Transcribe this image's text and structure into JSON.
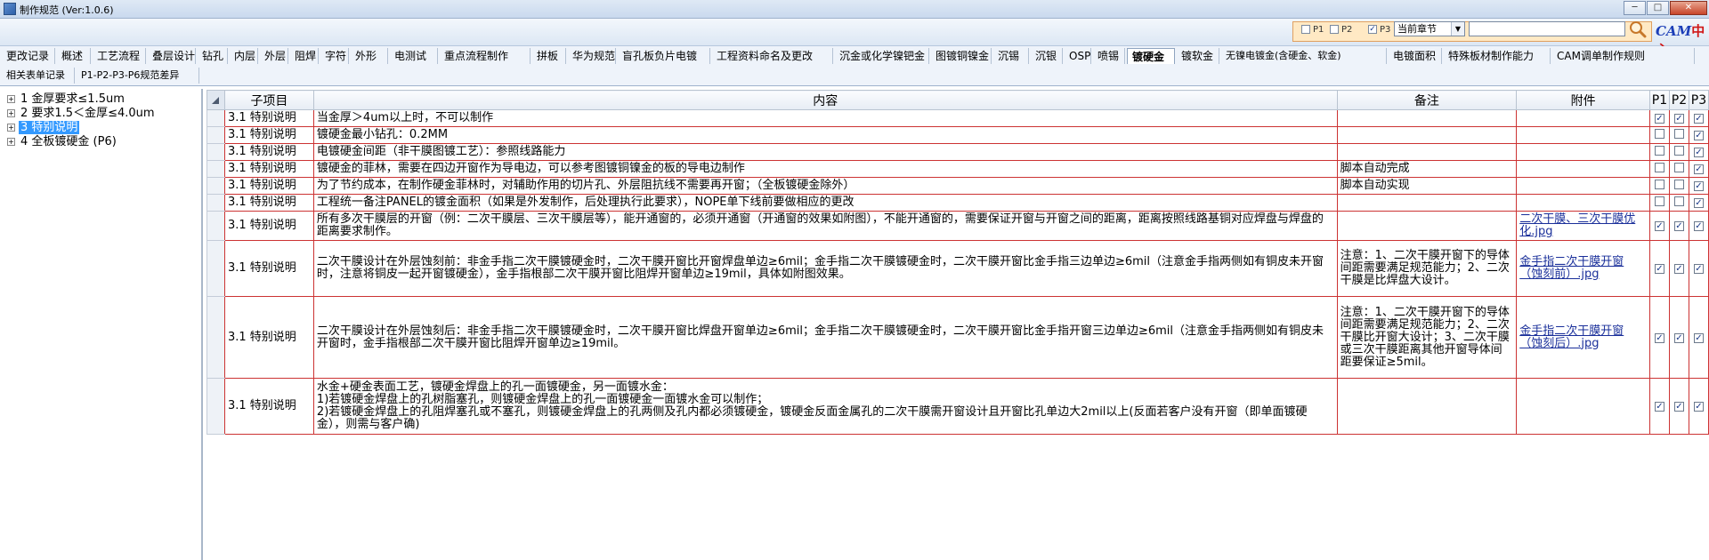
{
  "window": {
    "title": "制作规范 (Ver:1.0.6)",
    "controls": [
      "─",
      "□",
      "✕"
    ]
  },
  "toolbar": {
    "p1": {
      "label": "P1",
      "checked": false
    },
    "p2": {
      "label": "P2",
      "checked": false
    },
    "p3": {
      "label": "P3",
      "checked": true
    },
    "scope_select": "当前章节",
    "search_value": "",
    "brand_prefix": "CAM",
    "brand_suffix": "中心"
  },
  "tabs_row1": [
    "更改记录",
    "概述",
    "工艺流程",
    "叠层设计",
    "钻孔",
    "内层",
    "外层",
    "阻焊",
    "字符",
    "外形",
    "电测试",
    "重点流程制作",
    "拼板",
    "华为规范",
    "盲孔板负片电镀",
    "工程资料命名及更改",
    "沉金或化学镍钯金",
    "图镀铜镍金",
    "沉锡",
    "沉银",
    "OSP",
    "喷锡",
    "镀硬金",
    "镀软金",
    "无镍电镀金(含硬金、软金)",
    "电镀面积",
    "特殊板材制作能力",
    "CAM调单制作规则"
  ],
  "tabs_row2": [
    "相关表单记录",
    "P1-P2-P3-P6规范差异"
  ],
  "active_tab": "镀硬金",
  "tree": [
    {
      "label": "1 金厚要求≤1.5um",
      "selected": false
    },
    {
      "label": "2 要求1.5＜金厚≤4.0um",
      "selected": false
    },
    {
      "label": "3 特别说明",
      "selected": true
    },
    {
      "label": "4 全板镀硬金 (P6)",
      "selected": false
    }
  ],
  "table": {
    "headers": [
      "子项目",
      "内容",
      "备注",
      "附件",
      "P1",
      "P2",
      "P3"
    ],
    "rows": [
      {
        "sub": "3.1 特别说明",
        "content": "当金厚＞4um以上时，不可以制作",
        "note": "",
        "attach": "",
        "p": [
          true,
          true,
          true
        ]
      },
      {
        "sub": "3.1 特别说明",
        "content": "镀硬金最小钻孔：0.2MM",
        "note": "",
        "attach": "",
        "p": [
          false,
          false,
          true
        ]
      },
      {
        "sub": "3.1 特别说明",
        "content": "电镀硬金间距（非干膜图镀工艺）：参照线路能力",
        "note": "",
        "attach": "",
        "p": [
          false,
          false,
          true
        ]
      },
      {
        "sub": "3.1 特别说明",
        "content": "镀硬金的菲林，需要在四边开窗作为导电边，可以参考图镀铜镍金的板的导电边制作",
        "note": "脚本自动完成",
        "attach": "",
        "p": [
          false,
          false,
          true
        ]
      },
      {
        "sub": "3.1 特别说明",
        "content": "为了节约成本，在制作硬金菲林时，对辅助作用的切片孔、外层阻抗线不需要再开窗；（全板镀硬金除外）",
        "note": "脚本自动实现",
        "attach": "",
        "p": [
          false,
          false,
          true
        ]
      },
      {
        "sub": "3.1 特别说明",
        "content": "工程统一备注PANEL的镀金面积（如果是外发制作，后处理执行此要求），NOPE单下线前要做相应的更改",
        "note": "",
        "attach": "",
        "p": [
          false,
          false,
          true
        ]
      },
      {
        "sub": "3.1 特别说明",
        "content": "所有多次干膜层的开窗（例：二次干膜层、三次干膜层等），能开通窗的，必须开通窗（开通窗的效果如附图），不能开通窗的，需要保证开窗与开窗之间的距离，距离按照线路基铜对应焊盘与焊盘的距离要求制作。",
        "note": "",
        "attach": "二次干膜、三次干膜优化.jpg",
        "p": [
          true,
          true,
          true
        ]
      },
      {
        "sub": "3.1 特别说明",
        "content": "二次干膜设计在外层蚀刻前：非金手指二次干膜镀硬金时，二次干膜开窗比开窗焊盘单边≥6mil；金手指二次干膜镀硬金时，二次干膜开窗比金手指三边单边≥6mil（注意金手指两侧如有铜皮未开窗时，注意将铜皮一起开窗镀硬金），金手指根部二次干膜开窗比阻焊开窗单边≥19mil，具体如附图效果。",
        "note": "注意：1、二次干膜开窗下的导体间距需要满足规范能力；2、二次干膜是比焊盘大设计。",
        "attach": "金手指二次干膜开窗（蚀刻前）.jpg",
        "p": [
          true,
          true,
          true
        ]
      },
      {
        "sub": "3.1 特别说明",
        "content": "二次干膜设计在外层蚀刻后：非金手指二次干膜镀硬金时，二次干膜开窗比焊盘开窗单边≥6mil；金手指二次干膜镀硬金时，二次干膜开窗比金手指开窗三边单边≥6mil（注意金手指两侧如有铜皮未开窗时，金手指根部二次干膜开窗比阻焊开窗单边≥19mil。",
        "note": "注意：1、二次干膜开窗下的导体间距需要满足规范能力；2、二次干膜比开窗大设计；3、二次干膜或三次干膜距离其他开窗导体间距要保证≥5mil。",
        "attach": "金手指二次干膜开窗（蚀刻后）.jpg",
        "p": [
          true,
          true,
          true
        ]
      },
      {
        "sub": "3.1 特别说明",
        "content": "水金+硬金表面工艺，镀硬金焊盘上的孔一面镀硬金，另一面镀水金：\n1)若镀硬金焊盘上的孔树脂塞孔，则镀硬金焊盘上的孔一面镀硬金一面镀水金可以制作；\n2)若镀硬金焊盘上的孔阻焊塞孔或不塞孔，则镀硬金焊盘上的孔两侧及孔内都必须镀硬金，镀硬金反面金属孔的二次干膜需开窗设计且开窗比孔单边大2mil以上(反面若客户没有开窗（即单面镀硬金），则需与客户确)",
        "note": "",
        "attach": "",
        "p": [
          true,
          true,
          true
        ]
      }
    ]
  }
}
